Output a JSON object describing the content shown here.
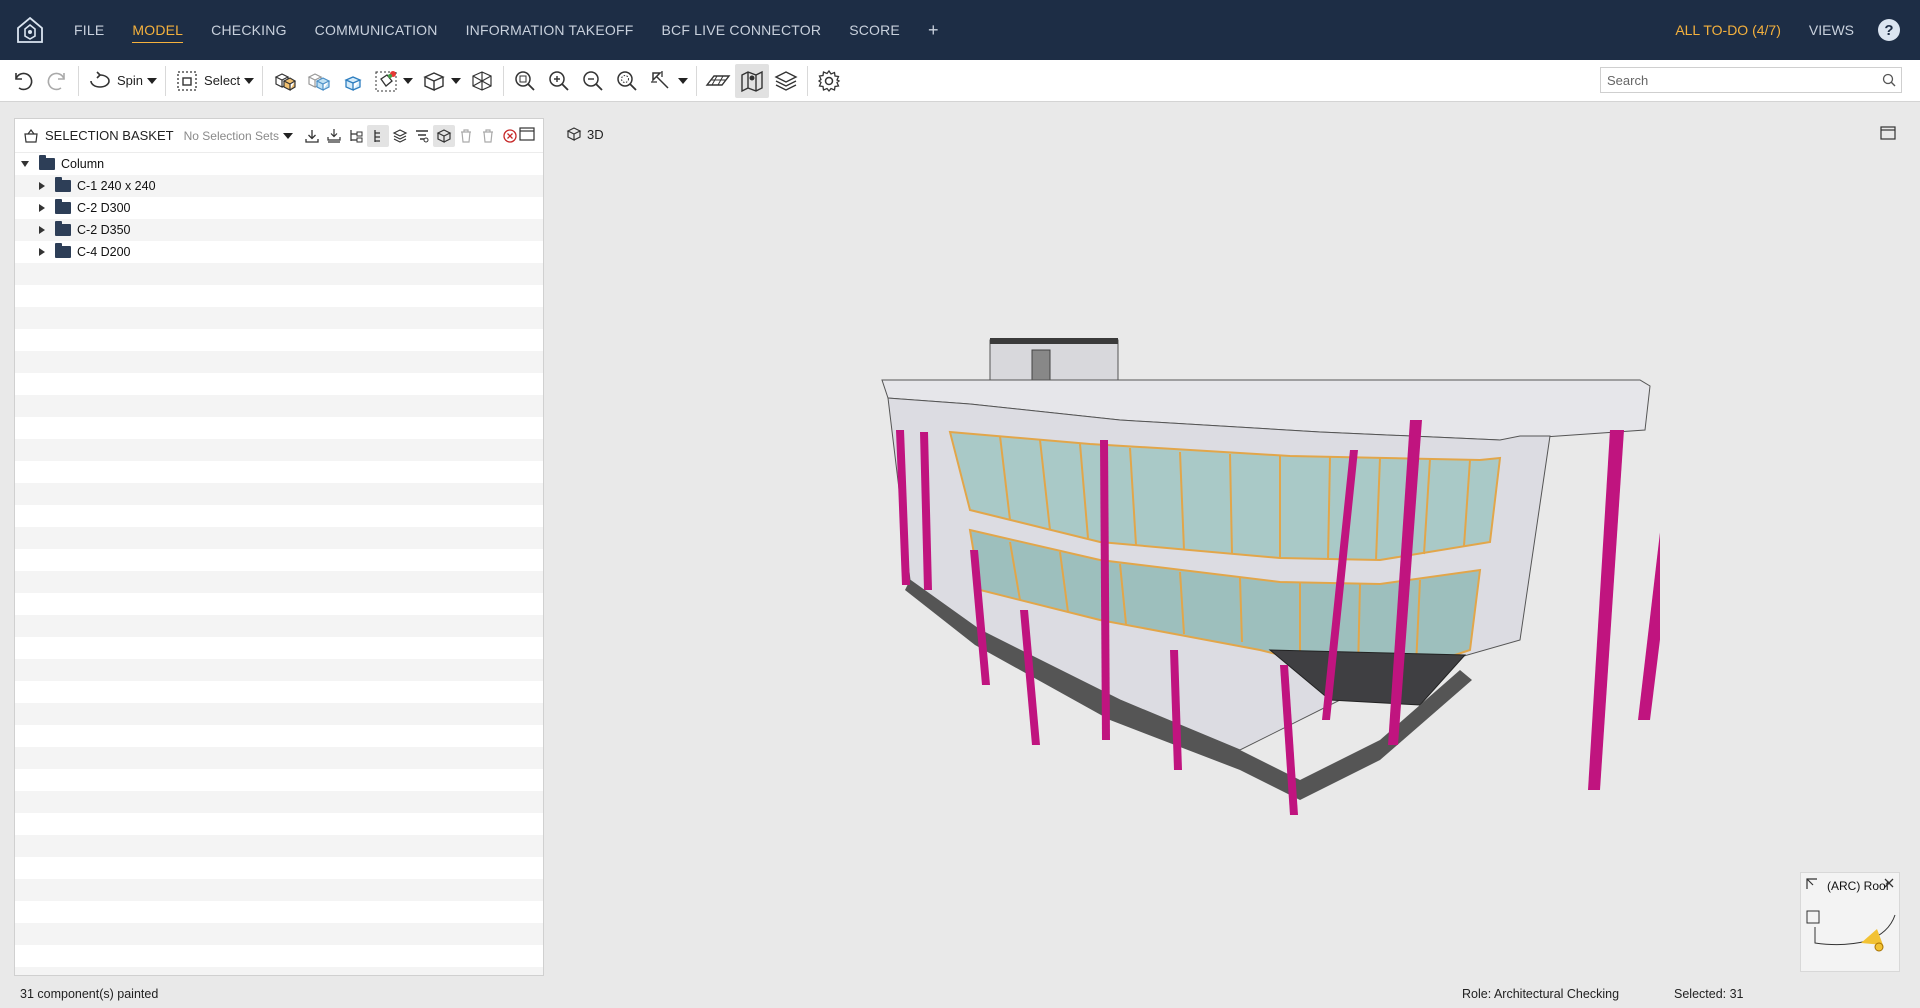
{
  "topbar": {
    "nav": [
      "FILE",
      "MODEL",
      "CHECKING",
      "COMMUNICATION",
      "INFORMATION TAKEOFF",
      "BCF LIVE CONNECTOR",
      "SCORE"
    ],
    "active": "MODEL",
    "plus": "+",
    "todo": "ALL TO-DO (4/7)",
    "views": "VIEWS",
    "help": "?"
  },
  "toolbar": {
    "spin_label": "Spin",
    "select_label": "Select",
    "search_placeholder": "Search"
  },
  "basket": {
    "title": "SELECTION BASKET",
    "sets_label": "No Selection Sets",
    "root": "Column",
    "children": [
      "C-1 240 x 240",
      "C-2 D300",
      "C-2 D350",
      "C-4 D200"
    ]
  },
  "viewport": {
    "tab_label": "3D"
  },
  "minimap": {
    "label": "(ARC) Roof"
  },
  "status": {
    "painted": "31 component(s) painted",
    "role": "Role: Architectural Checking",
    "selected": "Selected: 31"
  },
  "colors": {
    "nav_bg": "#1d2d45",
    "accent": "#f5b13d",
    "column": "#c0147f",
    "glass": "#a9c9c7",
    "frame": "#e2a64a"
  }
}
